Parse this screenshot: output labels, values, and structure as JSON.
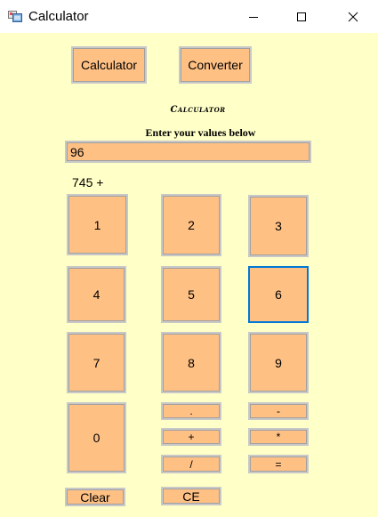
{
  "window": {
    "title": "Calculator"
  },
  "nav": {
    "calculator_label": "Calculator",
    "converter_label": "Converter"
  },
  "calculator": {
    "heading": "Calculator",
    "prompt": "Enter your values below",
    "input_value": "96",
    "expression": "745 +"
  },
  "keys": {
    "k1": "1",
    "k2": "2",
    "k3": "3",
    "k4": "4",
    "k5": "5",
    "k6": "6",
    "k7": "7",
    "k8": "8",
    "k9": "9",
    "k0": "0",
    "dot": ".",
    "minus": "-",
    "plus": "+",
    "multiply": "*",
    "divide": "/",
    "equals": "=",
    "clear": "Clear",
    "ce": "CE"
  },
  "colors": {
    "background": "#ffffc8",
    "button": "#ffc084",
    "focus": "#0078d7"
  }
}
